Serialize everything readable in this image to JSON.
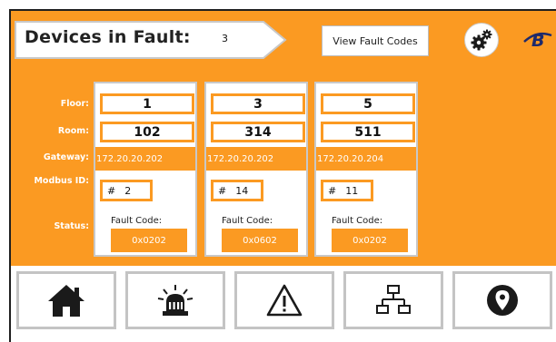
{
  "header": {
    "title": "Devices in Fault:",
    "fault_count": "3",
    "view_button_label": "View Fault Codes"
  },
  "row_labels": {
    "floor": "Floor:",
    "room": "Room:",
    "gateway": "Gateway:",
    "modbus": "Modbus ID:",
    "status": "Status:"
  },
  "devices": [
    {
      "floor": "1",
      "room": "102",
      "gateway": "172.20.20.202",
      "modbus_hash": "#",
      "modbus_id": "2",
      "fault_label": "Fault Code:",
      "fault_code": "0x0202"
    },
    {
      "floor": "3",
      "room": "314",
      "gateway": "172.20.20.202",
      "modbus_hash": "#",
      "modbus_id": "14",
      "fault_label": "Fault Code:",
      "fault_code": "0x0602"
    },
    {
      "floor": "5",
      "room": "511",
      "gateway": "172.20.20.204",
      "modbus_hash": "#",
      "modbus_id": "11",
      "fault_label": "Fault Code:",
      "fault_code": "0x0202"
    }
  ],
  "nav": {
    "items": [
      "home-icon",
      "alarm-light-icon",
      "warning-icon",
      "network-icon",
      "location-pin-icon"
    ]
  },
  "icons": {
    "settings": "gears-icon",
    "logo": "brand-logo-icon"
  },
  "colors": {
    "accent": "#fb9a22",
    "frame": "#1f1f1f",
    "text_dark": "#222222",
    "nav_border": "#c4c4c4"
  }
}
